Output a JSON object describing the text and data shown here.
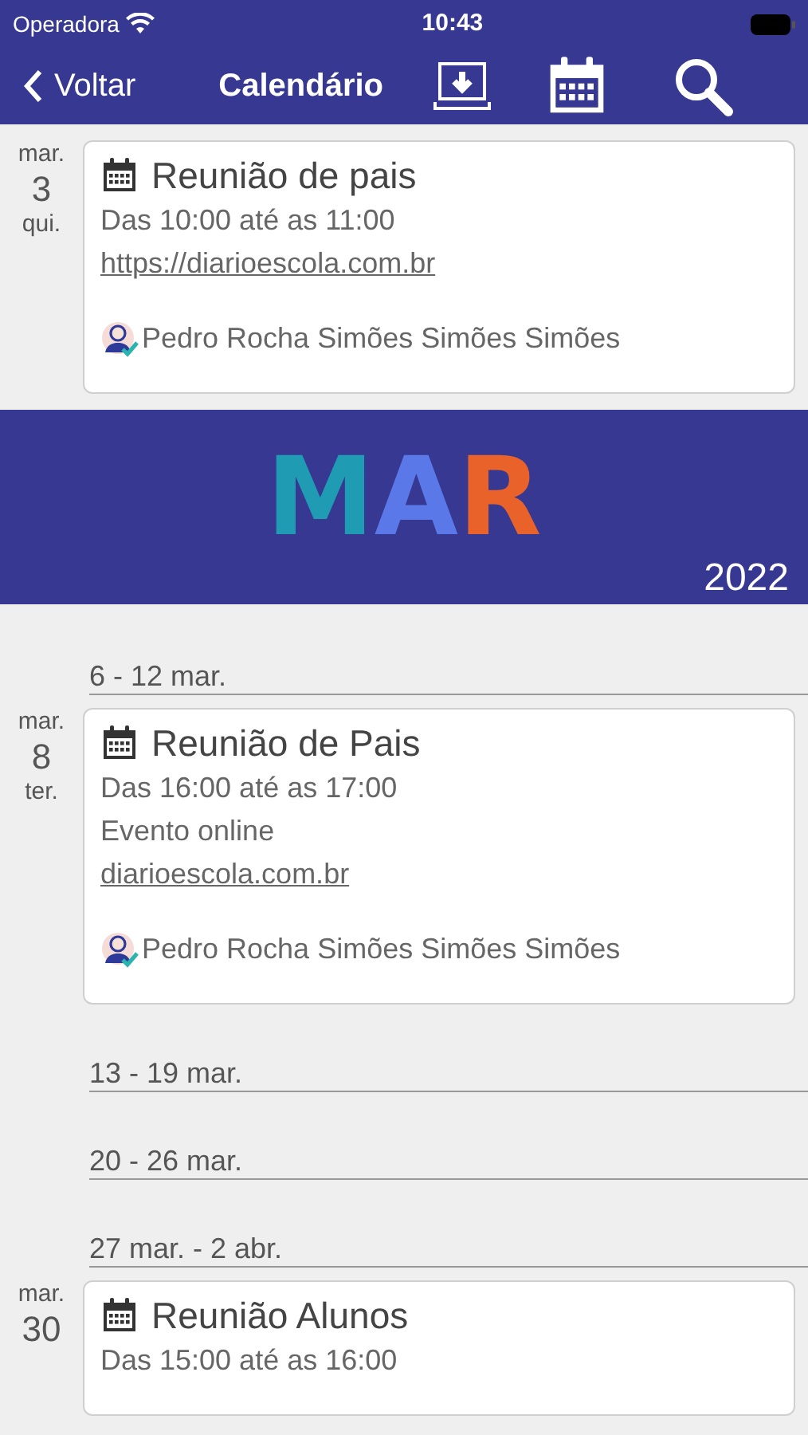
{
  "status_bar": {
    "carrier": "Operadora",
    "time": "10:43"
  },
  "nav": {
    "back": "Voltar",
    "title": "Calendário"
  },
  "items": [
    {
      "kind": "event",
      "date": {
        "month": "mar.",
        "day": "3",
        "weekday": "qui."
      },
      "title": "Reunião de pais",
      "lines": [
        {
          "kind": "text",
          "text": "Das 10:00 até as 11:00"
        },
        {
          "kind": "link",
          "text": "https://diarioescola.com.br"
        }
      ],
      "person": "Pedro Rocha Simões Simões Simões"
    },
    {
      "kind": "banner",
      "letters": [
        {
          "text": "M",
          "color": "#1f9bb3"
        },
        {
          "text": "A",
          "color": "#5b78e8"
        },
        {
          "text": "R",
          "color": "#e8622a"
        }
      ],
      "year": "2022"
    },
    {
      "kind": "week",
      "label": "6 - 12 mar."
    },
    {
      "kind": "event",
      "date": {
        "month": "mar.",
        "day": "8",
        "weekday": "ter."
      },
      "title": "Reunião de Pais",
      "lines": [
        {
          "kind": "text",
          "text": "Das 16:00 até as 17:00"
        },
        {
          "kind": "text",
          "text": "Evento online"
        },
        {
          "kind": "link",
          "text": "diarioescola.com.br"
        }
      ],
      "person": "Pedro Rocha Simões Simões Simões"
    },
    {
      "kind": "week",
      "label": "13 - 19 mar."
    },
    {
      "kind": "week",
      "label": "20 - 26 mar."
    },
    {
      "kind": "week",
      "label": "27 mar. - 2 abr."
    },
    {
      "kind": "event",
      "date": {
        "month": "mar.",
        "day": "30"
      },
      "title": "Reunião Alunos",
      "lines": [
        {
          "kind": "text",
          "text": "Das 15:00 até as 16:00"
        }
      ]
    }
  ]
}
